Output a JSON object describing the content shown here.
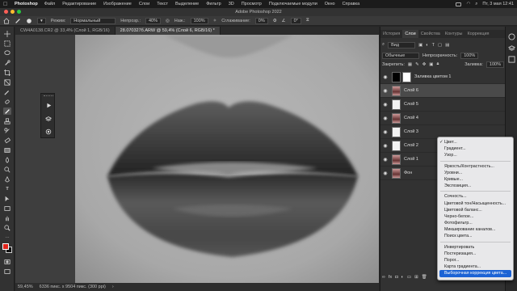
{
  "menubar": {
    "app": "Photoshop",
    "items": [
      "Файл",
      "Редактирование",
      "Изображение",
      "Слои",
      "Текст",
      "Выделение",
      "Фильтр",
      "3D",
      "Просмотр",
      "Подключаемые модули",
      "Окно",
      "Справка"
    ],
    "clock": "Пт, 3 мая 12:41"
  },
  "titlebar": {
    "title": "Adobe Photoshop 2022"
  },
  "options": {
    "mode_label": "Режим:",
    "mode_value": "Нормальный",
    "opacity_label": "Непрозр.:",
    "opacity_value": "40%",
    "pressure_label": "Наж.:",
    "pressure_value": "100%",
    "smoothing_label": "Сглаживание:",
    "smoothing_value": "0%",
    "angle_value": "0°"
  },
  "tabs": [
    {
      "label": "CW4A0138.CR2 @ 33,4% (Слой 1, RGB/16)"
    },
    {
      "label": "28.070327б.ARW @ 59,4% (Слой 6, RGB/16) *"
    }
  ],
  "status": {
    "zoom": "59,45%",
    "doc_size": "6336 пикс. x 9504 пикс. (300 ppi)"
  },
  "panels": {
    "tabs": [
      "История",
      "Слои",
      "Свойства",
      "Контуры",
      "Коррекция"
    ],
    "active_tab": "Слои",
    "filter_value": "Вид",
    "blend_mode": "Обычные",
    "opacity_label": "Непрозрачность:",
    "opacity_value": "100%",
    "lock_label": "Закрепить:",
    "fill_label": "Заливка:",
    "fill_value": "100%",
    "layers": [
      {
        "name": "Заливка цветом 1",
        "type": "fill"
      },
      {
        "name": "Слой 6",
        "type": "photo"
      },
      {
        "name": "Слой 5",
        "type": "blank"
      },
      {
        "name": "Слой 4",
        "type": "photo"
      },
      {
        "name": "Слой 3",
        "type": "blank"
      },
      {
        "name": "Слой 2",
        "type": "blank"
      },
      {
        "name": "Слой 1",
        "type": "photo"
      },
      {
        "name": "Фон",
        "type": "photo"
      }
    ]
  },
  "adjust_menu": {
    "groups": [
      [
        "Цвет...",
        "Градиент...",
        "Узор..."
      ],
      [
        "Яркость/Контрастность...",
        "Уровни...",
        "Кривые...",
        "Экспозиция..."
      ],
      [
        "Сочность...",
        "Цветовой тон/Насыщенность...",
        "Цветовой баланс...",
        "Черно-белое...",
        "Фотофильтр...",
        "Микширование каналов...",
        "Поиск цвета..."
      ],
      [
        "Инвертировать",
        "Постеризация...",
        "Порог...",
        "Карта градиента...",
        "Выборочная коррекция цвета..."
      ]
    ],
    "checked": "Цвет...",
    "highlighted": "Выборочная коррекция цвета..."
  },
  "colors": {
    "foreground": "#e0241b",
    "background": "#111111",
    "highlight": "#1c63d5"
  }
}
